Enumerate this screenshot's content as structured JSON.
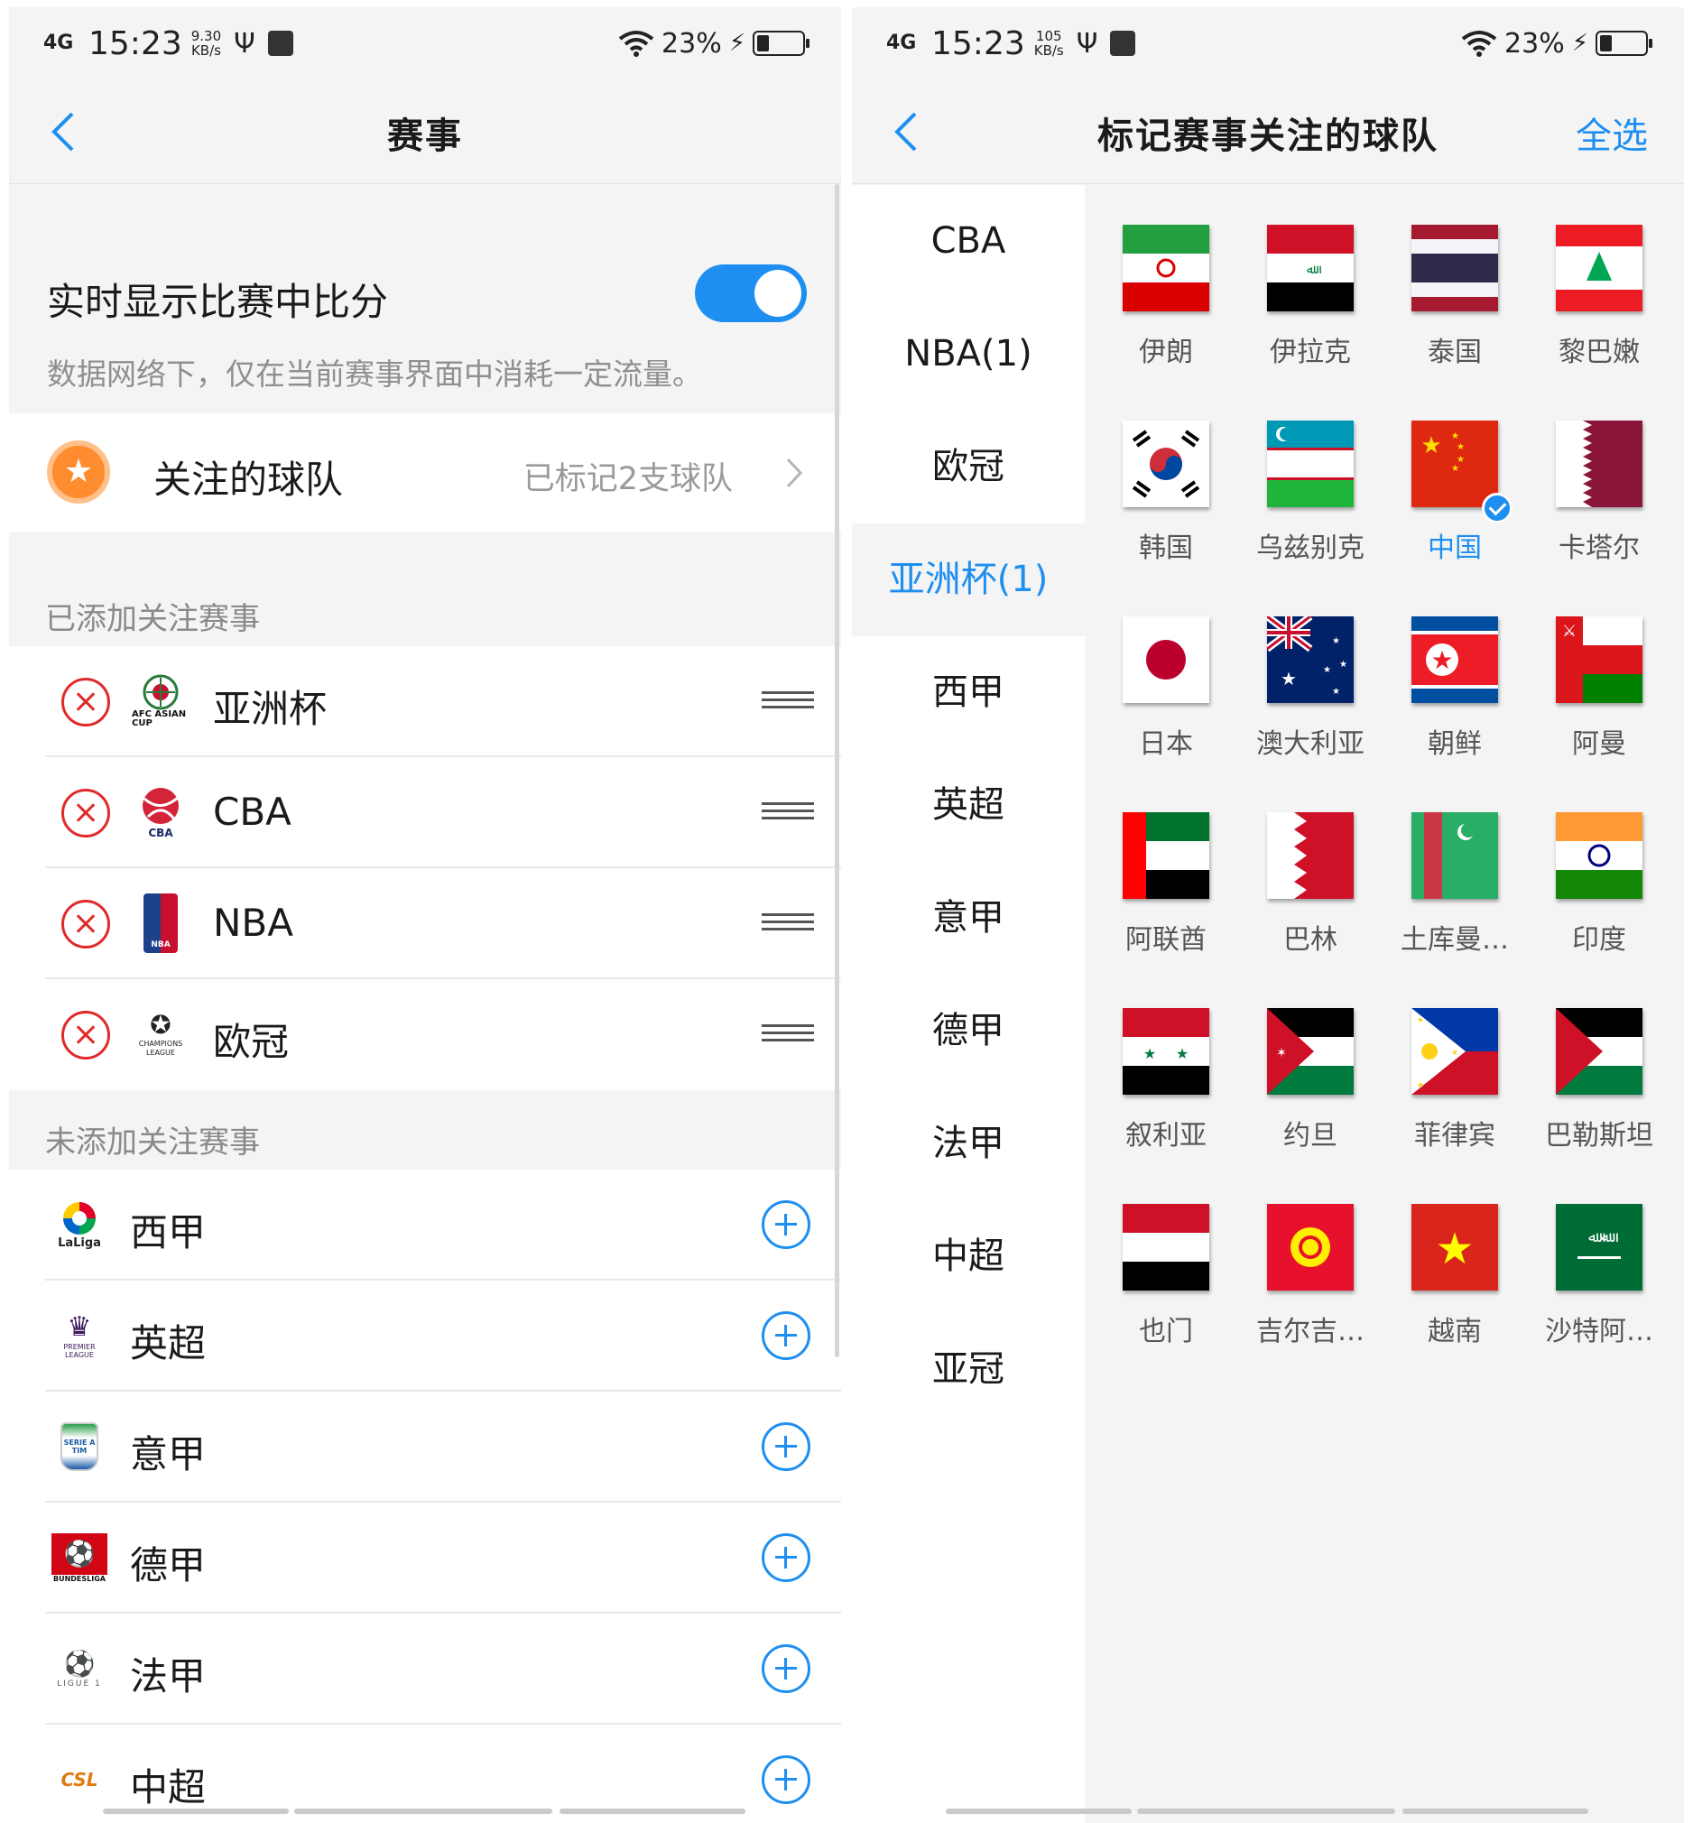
{
  "status_bar_left": {
    "network": "4G",
    "time": "15:23",
    "speed": "9.30",
    "speed_unit": "KB/s",
    "battery": "23%"
  },
  "status_bar_right": {
    "network": "4G",
    "time": "15:23",
    "speed": "105",
    "speed_unit": "KB/s",
    "battery": "23%"
  },
  "left": {
    "nav_title": "赛事",
    "realtime": {
      "title": "实时显示比赛中比分",
      "desc": "数据网络下，仅在当前赛事界面中消耗一定流量。",
      "enabled": true
    },
    "favorite": {
      "title": "关注的球队",
      "value": "已标记2支球队"
    },
    "added_label": "已添加关注赛事",
    "added": [
      {
        "name": "亚洲杯",
        "logo_text": "AFC ASIAN CUP",
        "icon": "afc-asian-cup-logo"
      },
      {
        "name": "CBA",
        "logo_text": "CBA",
        "icon": "cba-logo"
      },
      {
        "name": "NBA",
        "logo_text": "NBA",
        "icon": "nba-logo"
      },
      {
        "name": "欧冠",
        "logo_text": "CHAMPIONS LEAGUE",
        "icon": "champions-league-logo"
      }
    ],
    "not_added_label": "未添加关注赛事",
    "not_added": [
      {
        "name": "西甲",
        "logo_text": "LaLiga",
        "icon": "laliga-logo"
      },
      {
        "name": "英超",
        "logo_text": "PREMIER LEAGUE",
        "icon": "premier-league-logo"
      },
      {
        "name": "意甲",
        "logo_text": "SERIE A TIM",
        "icon": "serie-a-logo"
      },
      {
        "name": "德甲",
        "logo_text": "BUNDESLIGA",
        "icon": "bundesliga-logo"
      },
      {
        "name": "法甲",
        "logo_text": "LIGUE 1",
        "icon": "ligue-1-logo"
      },
      {
        "name": "中超",
        "logo_text": "CSL",
        "icon": "csl-logo"
      }
    ]
  },
  "right": {
    "nav_title": "标记赛事关注的球队",
    "select_all": "全选",
    "menu": [
      "CBA",
      "NBA(1)",
      "欧冠",
      "亚洲杯(1)",
      "西甲",
      "英超",
      "意甲",
      "德甲",
      "法甲",
      "中超",
      "亚冠"
    ],
    "active_menu_index": 3,
    "teams": [
      {
        "name": "伊朗",
        "flag": "iran-flag",
        "selected": false
      },
      {
        "name": "伊拉克",
        "flag": "iraq-flag",
        "selected": false
      },
      {
        "name": "泰国",
        "flag": "thailand-flag",
        "selected": false
      },
      {
        "name": "黎巴嫩",
        "flag": "lebanon-flag",
        "selected": false
      },
      {
        "name": "韩国",
        "flag": "south-korea-flag",
        "selected": false
      },
      {
        "name": "乌兹别克",
        "flag": "uzbekistan-flag",
        "selected": false
      },
      {
        "name": "中国",
        "flag": "china-flag",
        "selected": true
      },
      {
        "name": "卡塔尔",
        "flag": "qatar-flag",
        "selected": false
      },
      {
        "name": "日本",
        "flag": "japan-flag",
        "selected": false
      },
      {
        "name": "澳大利亚",
        "flag": "australia-flag",
        "selected": false
      },
      {
        "name": "朝鲜",
        "flag": "north-korea-flag",
        "selected": false
      },
      {
        "name": "阿曼",
        "flag": "oman-flag",
        "selected": false
      },
      {
        "name": "阿联酋",
        "flag": "uae-flag",
        "selected": false
      },
      {
        "name": "巴林",
        "flag": "bahrain-flag",
        "selected": false
      },
      {
        "name": "土库曼…",
        "flag": "turkmenistan-flag",
        "selected": false
      },
      {
        "name": "印度",
        "flag": "india-flag",
        "selected": false
      },
      {
        "name": "叙利亚",
        "flag": "syria-flag",
        "selected": false
      },
      {
        "name": "约旦",
        "flag": "jordan-flag",
        "selected": false
      },
      {
        "name": "菲律宾",
        "flag": "philippines-flag",
        "selected": false
      },
      {
        "name": "巴勒斯坦",
        "flag": "palestine-flag",
        "selected": false
      },
      {
        "name": "也门",
        "flag": "yemen-flag",
        "selected": false
      },
      {
        "name": "吉尔吉…",
        "flag": "kyrgyzstan-flag",
        "selected": false
      },
      {
        "name": "越南",
        "flag": "vietnam-flag",
        "selected": false
      },
      {
        "name": "沙特阿…",
        "flag": "saudi-arabia-flag",
        "selected": false
      }
    ]
  },
  "colors": {
    "accent": "#1e8ff0",
    "remove": "#e02a2a",
    "favorite": "#ff8c2e"
  }
}
